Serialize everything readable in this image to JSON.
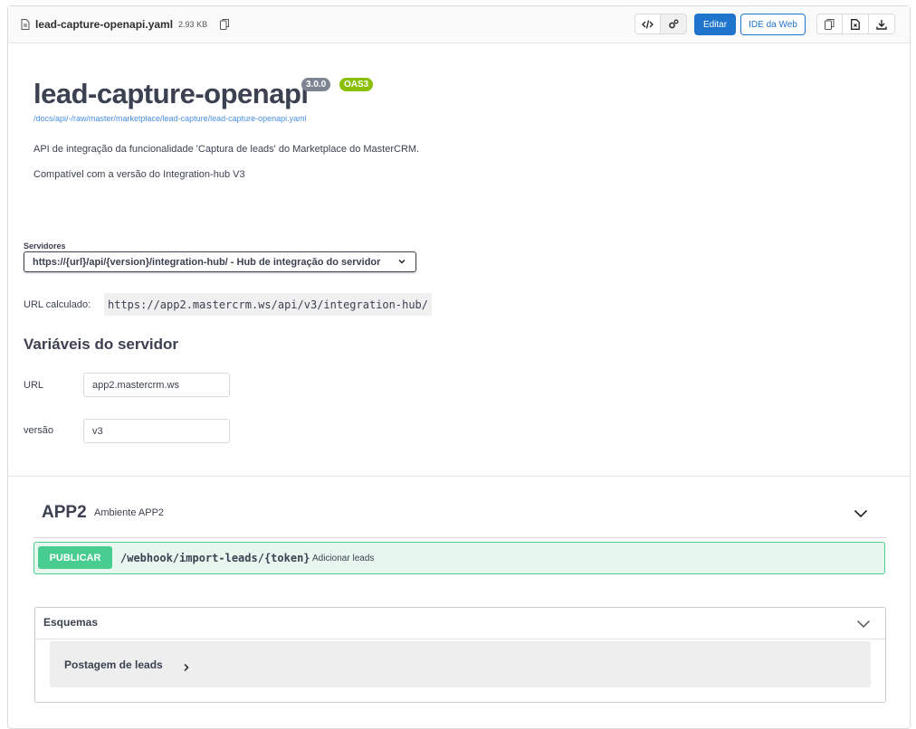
{
  "file": {
    "name": "lead-capture-openapi.yaml",
    "size": "2.93 KB",
    "edit_label": "Editar",
    "ide_label": "IDE da Web"
  },
  "info": {
    "title": "lead-capture-openapi",
    "version_badge": "3.0.0",
    "oas_badge": "OAS3",
    "url": "/docs/api/-/raw/master/marketplace/lead-capture/lead-capture-openapi.yaml",
    "description_1": "API de integração da funcionalidade 'Captura de leads' do Marketplace do MasterCRM.",
    "description_2": "Compatível com a versão do Integration-hub V3"
  },
  "servers": {
    "label": "Servidores",
    "selected": "https://{url}/api/{version}/integration-hub/ - Hub de integração do servidor",
    "computed_label": "URL calculado:",
    "computed_url": "https://app2.mastercrm.ws/api/v3/integration-hub/",
    "variables_heading": "Variáveis do servidor",
    "variables": [
      {
        "name": "URL",
        "value": "app2.mastercrm.ws"
      },
      {
        "name": "versão",
        "value": "v3"
      }
    ]
  },
  "tag": {
    "name": "APP2",
    "description": "Ambiente APP2",
    "operation": {
      "method": "PUBLICAR",
      "path": "/webhook/import-leads/{token}",
      "summary": "Adicionar leads"
    }
  },
  "schemas": {
    "title": "Esquemas",
    "models": [
      "Postagem de leads"
    ]
  },
  "colors": {
    "accent": "#1f75cb",
    "post_green": "#49cc90",
    "oas_green": "#89bf04",
    "version_gray": "#7d8492"
  }
}
